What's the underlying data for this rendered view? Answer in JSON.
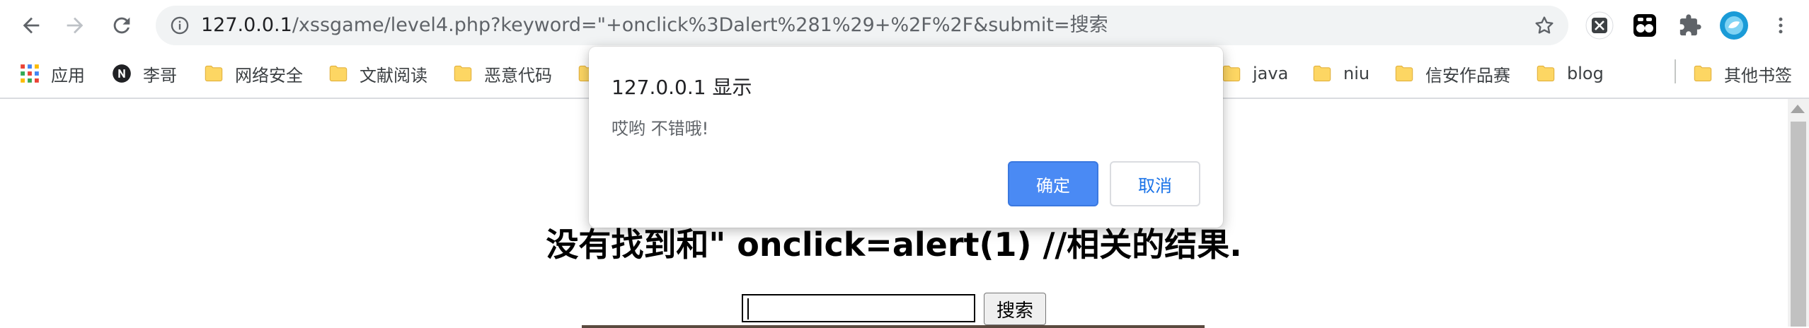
{
  "browser": {
    "url_host": "127.0.0.1",
    "url_rest": "/xssgame/level4.php?keyword=\"+onclick%3Dalert%281%29+%2F%2F&submit=搜索",
    "nav": [
      "back-icon",
      "forward-icon",
      "reload-icon"
    ],
    "extensions": [
      "xss-extension-icon",
      "tampermonkey-icon",
      "puzzle-extensions-icon",
      "profile-avatar-icon",
      "more-menu-icon"
    ]
  },
  "bookmarks": {
    "apps_label": "应用",
    "items": [
      {
        "label": "李哥",
        "icon": "notion-icon"
      },
      {
        "label": "网络安全",
        "icon": "folder-icon"
      },
      {
        "label": "文献阅读",
        "icon": "folder-icon"
      },
      {
        "label": "恶意代码",
        "icon": "folder-icon"
      },
      {
        "label": "java",
        "icon": "folder-icon"
      },
      {
        "label": "niu",
        "icon": "folder-icon"
      },
      {
        "label": "信安作品赛",
        "icon": "folder-icon"
      },
      {
        "label": "blog",
        "icon": "folder-icon"
      }
    ],
    "other_label": "其他书签"
  },
  "dialog": {
    "title": "127.0.0.1 显示",
    "message": "哎哟 不错哦!",
    "ok_label": "确定",
    "cancel_label": "取消"
  },
  "page": {
    "heading": "没有找到和\" onclick=alert(1) //相关的结果.",
    "search_value": "",
    "search_button": "搜索"
  },
  "colors": {
    "accent": "#4a8af4",
    "folder": "#fdd663",
    "omnibox": "#f1f3f4"
  }
}
